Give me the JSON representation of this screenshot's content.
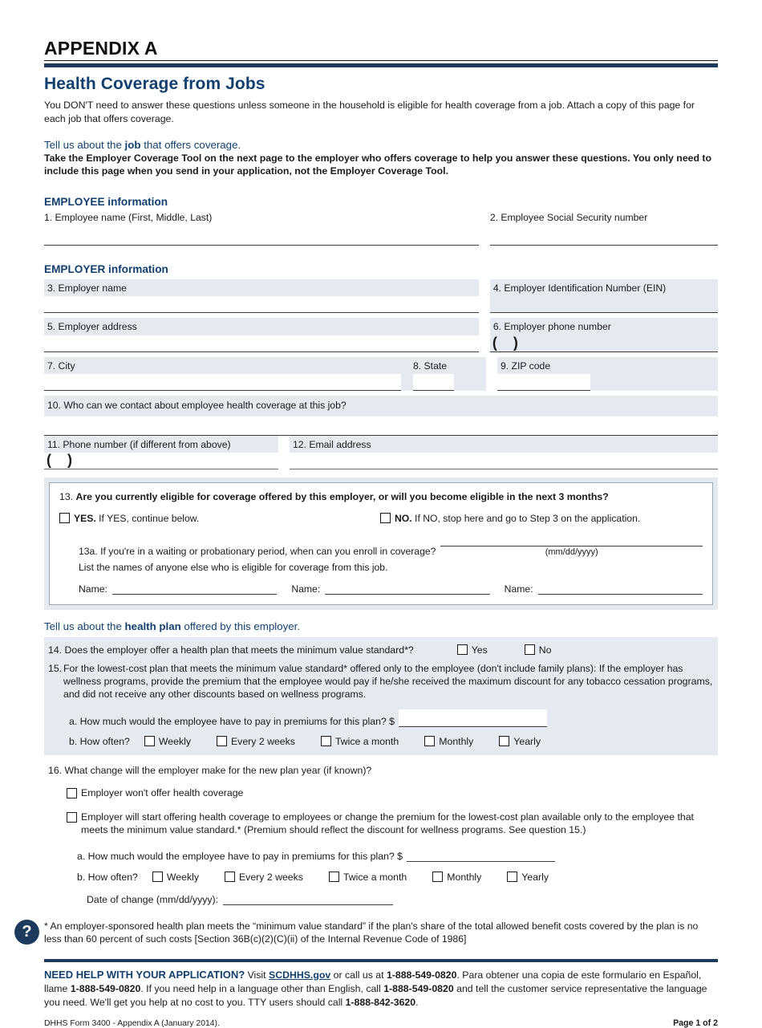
{
  "header": {
    "appendix": "APPENDIX A",
    "title": "Health Coverage from Jobs",
    "intro": "You DON'T need to answer these questions unless someone in the household is eligible for health coverage from a job. Attach a copy of this page for each job that offers coverage.",
    "lede_pre": "Tell us about the ",
    "lede_bold": "job",
    "lede_post": " that offers coverage.",
    "lede_body": "Take the Employer Coverage Tool on the next page to the employer who offers coverage to help you answer these questions. You only need to include this page when you send in your application, not the Employer Coverage Tool."
  },
  "employee": {
    "heading": "EMPLOYEE information",
    "q1": "1. Employee name (First, Middle, Last)",
    "q2": "2. Employee Social Security number"
  },
  "employer": {
    "heading": "EMPLOYER information",
    "q3": "3. Employer name",
    "q4": "4. Employer Identification Number (EIN)",
    "q5": "5. Employer address",
    "q6": "6. Employer phone number",
    "q7": "7. City",
    "q8": "8. State",
    "q9": "9. ZIP code",
    "q10": "10. Who can we contact about employee health coverage at this job?",
    "q11": "11. Phone number (if different from above)",
    "q12": "12. Email address",
    "paren_open": "(",
    "paren_close": ")"
  },
  "q13": {
    "number": "13. ",
    "question": "Are you currently eligible for coverage offered by this employer, or will you become eligible in the next 3 months?",
    "yes_bold": "YES.",
    "yes_rest": " If YES, continue below.",
    "no_bold": "NO.",
    "no_rest": " If NO, stop here and go to Step 3 on the application.",
    "q13a": "13a. If you're in a waiting or probationary period, when can you enroll in coverage?",
    "date_format": "(mm/dd/yyyy)",
    "list_prompt": "List the names of anyone else who is eligible for coverage from this job.",
    "name_label": "Name:"
  },
  "plan": {
    "lede_pre": "Tell us about the ",
    "lede_bold": "health plan",
    "lede_post": " offered by this employer.",
    "q14": "14. Does the employer offer a health plan that meets the minimum value standard*?",
    "q14_yes": "Yes",
    "q14_no": "No",
    "q15_num": "15.",
    "q15": "For the lowest-cost plan that meets the minimum value standard* offered only to the employee (don't include family plans): If the employer has wellness programs, provide the premium that the employee would pay if he/she received the maximum discount for any tobacco cessation programs, and did not receive any other discounts based on wellness programs.",
    "q15a": "a. How much would the employee have to pay in premiums for this plan? $",
    "q15b": "b. How often?",
    "freq": [
      "Weekly",
      "Every 2 weeks",
      "Twice a month",
      "Monthly",
      "Yearly"
    ]
  },
  "q16": {
    "question": "16. What change will the employer make for the new plan year (if known)?",
    "opt1": "Employer won't offer health coverage",
    "opt2": "Employer will start offering health coverage to employees or change the premium for the lowest-cost plan available only to the employee that meets the minimum value standard.* (Premium should reflect the discount for wellness programs. See question 15.)",
    "a": "a. How much would the employee have to pay in premiums for this plan? $",
    "b": "b. How often?",
    "freq": [
      "Weekly",
      "Every 2 weeks",
      "Twice a month",
      "Monthly",
      "Yearly"
    ],
    "date_label": "Date of change (mm/dd/yyyy):"
  },
  "footnote": "* An employer-sponsored health plan meets the “minimum value standard” if the plan's share of the total allowed benefit costs covered by the plan is no less than 60 percent of such costs [Section 36B(c)(2)(C)(ii) of the Internal Revenue Code of 1986]",
  "footer": {
    "help_heading": "NEED HELP WITH YOUR APPLICATION?",
    "help_1": " Visit ",
    "help_link": "SCDHHS.gov",
    "help_2": " or call us at ",
    "phone_1": "1-888-549-0820",
    "help_3": ". Para obtener una copia de este formulario en Español, llame ",
    "phone_2": "1-888-549-0820",
    "help_4": ". If you need help in a language other than English, call ",
    "phone_3": "1-888-549-0820",
    "help_5": " and tell the customer service representative the language you need. We'll get you help at no cost to you. TTY users should call ",
    "phone_tty": "1-888-842-3620",
    "help_6": ".",
    "form_id": "DHHS Form 3400 - Appendix A (January 2014).",
    "page": "Page 1 of 2",
    "question_icon": "?"
  },
  "colors": {
    "navy": "#1b3a5c",
    "heading_blue": "#11406e",
    "field_shade": "#e4eaef"
  }
}
